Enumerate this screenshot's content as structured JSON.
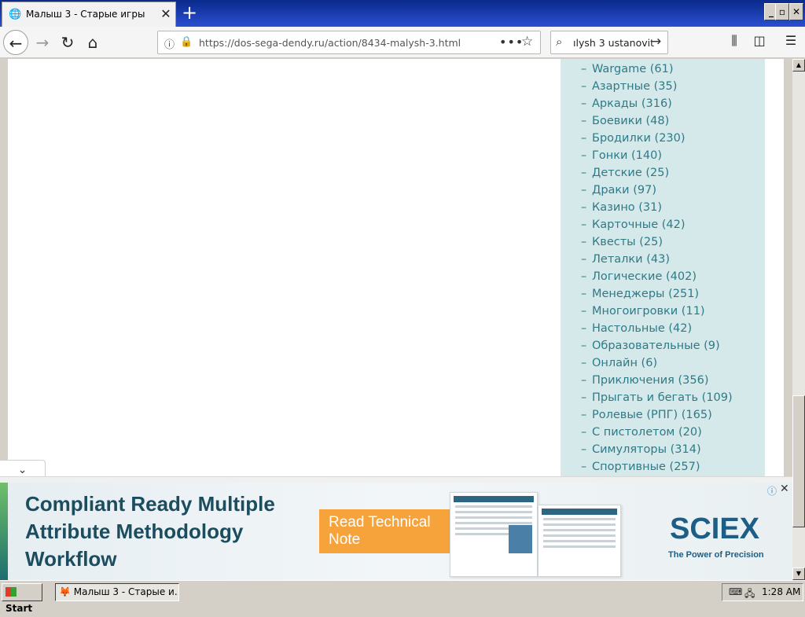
{
  "browser": {
    "tab_title": "Малыш 3 - Старые игры",
    "tab_close": "✕",
    "new_tab": "+",
    "url": "https://dos-sega-dendy.ru/action/8434-malysh-3.html",
    "search_text": "ılysh 3 ustanovit",
    "window_buttons": {
      "minimize": "_",
      "maximize": "▫",
      "close": "✕"
    }
  },
  "sidebar": {
    "categories": [
      {
        "label": "Wargame (61)"
      },
      {
        "label": "Азартные (35)"
      },
      {
        "label": "Аркады (316)"
      },
      {
        "label": "Боевики (48)"
      },
      {
        "label": "Бродилки (230)"
      },
      {
        "label": "Гонки (140)"
      },
      {
        "label": "Детские (25)"
      },
      {
        "label": "Драки (97)"
      },
      {
        "label": "Казино (31)"
      },
      {
        "label": "Карточные (42)"
      },
      {
        "label": "Квесты (25)"
      },
      {
        "label": "Леталки (43)"
      },
      {
        "label": "Логические (402)"
      },
      {
        "label": "Менеджеры (251)"
      },
      {
        "label": "Многоигровки (11)"
      },
      {
        "label": "Настольные (42)"
      },
      {
        "label": "Образовательные (9)"
      },
      {
        "label": "Онлайн (6)"
      },
      {
        "label": "Приключения (356)"
      },
      {
        "label": "Прыгать и бегать (109)"
      },
      {
        "label": "Ролевые (РПГ) (165)"
      },
      {
        "label": "С пистолетом (20)"
      },
      {
        "label": "Симуляторы (314)"
      },
      {
        "label": "Спортивные (257)"
      }
    ]
  },
  "ad": {
    "headline": "Compliant Ready Multiple Attribute Methodology Workflow",
    "cta": "Read Technical Note",
    "brand": "SCIEX",
    "tagline": "The Power of Precision"
  },
  "taskbar": {
    "start_label": "Start",
    "task_label": "Малыш 3 - Старые и...",
    "clock": "1:28 AM"
  },
  "colors": {
    "sidebar_bg": "#d6e9ea",
    "link": "#2e7a87",
    "ad_cta": "#f7a33b",
    "ad_brand": "#1d5e86"
  }
}
